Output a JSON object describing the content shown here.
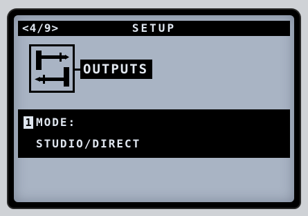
{
  "header": {
    "page_indicator": "<4/9>",
    "title": "SETUP"
  },
  "section": {
    "icon": "output-jacks-icon",
    "label": "OUTPUTS"
  },
  "parameter": {
    "number": "1",
    "name": "MODE:",
    "value": "STUDIO/DIRECT"
  },
  "colors": {
    "lcd_background": "#a9b4c4",
    "bar_background": "#000000",
    "bar_text": "#dfe6ef"
  }
}
